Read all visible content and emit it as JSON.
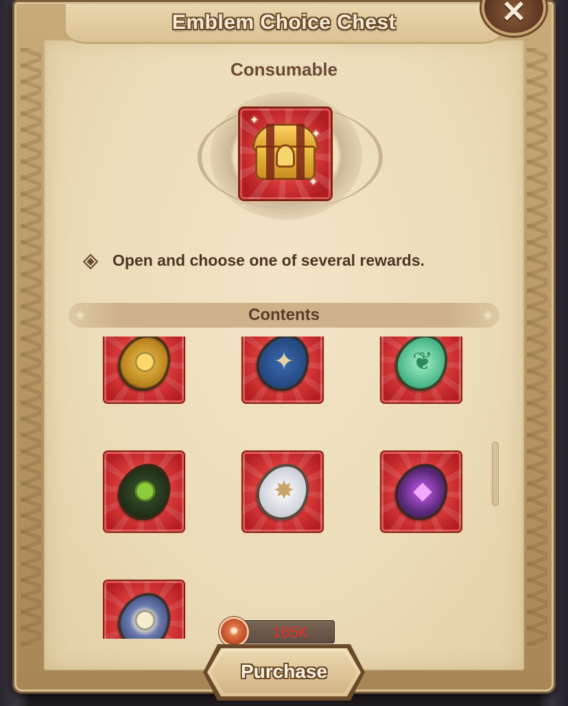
{
  "dialog": {
    "title": "Emblem Choice Chest",
    "item_type": "Consumable",
    "item_icon": "treasure-chest-icon",
    "description": "Open and choose one of several rewards.",
    "contents_label": "Contents",
    "close_icon": "close-icon"
  },
  "contents": {
    "items": [
      {
        "icon": "gold-emblem-icon",
        "color": "#d9a93a"
      },
      {
        "icon": "blue-star-emblem-icon",
        "color": "#2e5a9a"
      },
      {
        "icon": "green-leaf-emblem-icon",
        "color": "#5ac79a"
      },
      {
        "icon": "dark-green-eye-emblem-icon",
        "color": "#2a3a22"
      },
      {
        "icon": "silver-star-emblem-icon",
        "color": "#dcdde2"
      },
      {
        "icon": "purple-emblem-icon",
        "color": "#5a2a7a"
      },
      {
        "icon": "blue-shield-emblem-icon",
        "color": "#4a5a8a"
      }
    ]
  },
  "purchase": {
    "price": "165K",
    "currency_icon": "coin-icon",
    "button_label": "Purchase",
    "price_color": "#ee2a2a"
  }
}
